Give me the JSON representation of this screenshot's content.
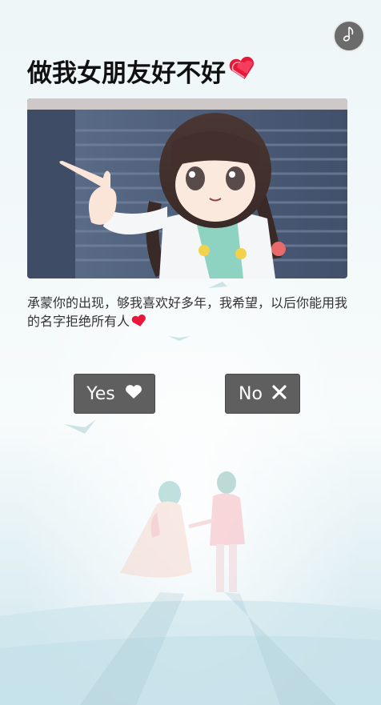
{
  "page": {
    "title": "做我女朋友好不好",
    "message": "承蒙你的出现，够我喜欢好多年，我希望，以后你能用我的名字拒绝所有人"
  },
  "buttons": {
    "yes_label": "Yes",
    "no_label": "No"
  },
  "icons": {
    "music": "music-note-icon",
    "title_heart": "heart-icon",
    "message_heart": "heart-icon",
    "yes": "heart-icon",
    "no": "close-icon"
  },
  "colors": {
    "button_bg": "#5f5f5f",
    "heart": "#e8183b",
    "title": "#111111",
    "text": "#333333"
  }
}
